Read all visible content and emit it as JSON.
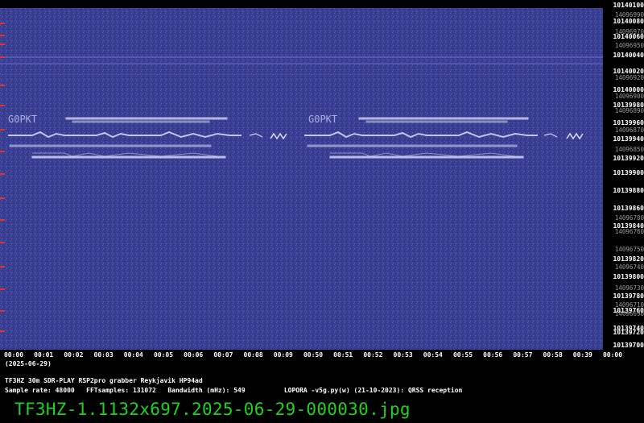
{
  "waterfall": {
    "background": "#3a3e92",
    "signal_color": "#d8dcf6",
    "marker_color": "#dd3333",
    "callsign_segment_1": "G0PKT",
    "callsign_segment_2": "G0PKT"
  },
  "y_axis": {
    "labels": [
      "10140100",
      "14096990",
      "10140080",
      "14096970",
      "10140060",
      "14096950",
      "10140040",
      "10140020",
      "14096920",
      "10140000",
      "14096900",
      "10139980",
      "14096890",
      "10139960",
      "14096870",
      "10139940",
      "14096850",
      "10139920",
      "10139900",
      "10139880",
      "10139860",
      "14096780",
      "10139840",
      "14096760",
      "14096750",
      "10139820",
      "14096740",
      "10139800",
      "14096730",
      "10139780",
      "14096710",
      "10139760",
      "14096690",
      "10139740",
      "10139720",
      "10139700"
    ]
  },
  "x_axis": {
    "labels": [
      "00:00",
      "00:01",
      "00:02",
      "00:03",
      "00:04",
      "00:05",
      "00:06",
      "00:07",
      "00:08",
      "00:09",
      "00:50",
      "00:51",
      "00:52",
      "00:53",
      "00:54",
      "00:55",
      "00:56",
      "00:57",
      "00:58",
      "00:39",
      "00:00"
    ],
    "date": "(2025-06-29)"
  },
  "info": {
    "line1": "TF3HZ 30m SDR-PLAY RSP2pro grabber Reykjavik HP94ad",
    "sample_rate": "Sample rate: 48000",
    "fft_samples": "FFTsamples: 131072",
    "bandwidth": "Bandwidth (mHz): 549",
    "software": "LOPORA -v5g.py(w) (21-10-2023): QRSS reception"
  },
  "filename": "TF3HZ-1.1132x697.2025-06-29-000030.jpg"
}
